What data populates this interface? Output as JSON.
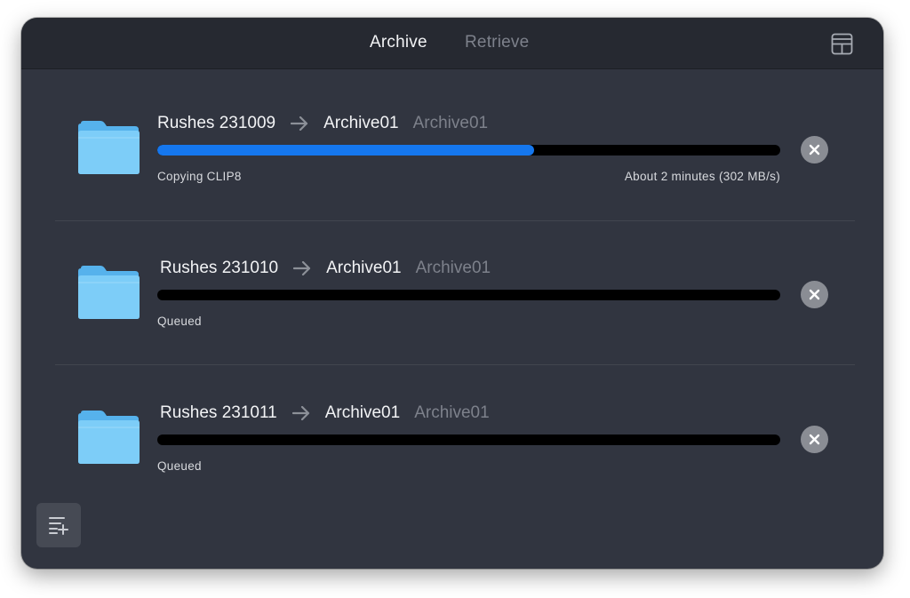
{
  "tabs": {
    "archive": "Archive",
    "retrieve": "Retrieve"
  },
  "jobs": [
    {
      "source": "Rushes 231009",
      "destination": "Archive01",
      "destination_secondary": "Archive01",
      "progress_percent": 60.5,
      "status": "Copying CLIP8",
      "eta": "About 2 minutes (302 MB/s)"
    },
    {
      "source": "Rushes 231010",
      "destination": "Archive01",
      "destination_secondary": "Archive01",
      "progress_percent": 0,
      "status": "Queued",
      "eta": ""
    },
    {
      "source": "Rushes 231011",
      "destination": "Archive01",
      "destination_secondary": "Archive01",
      "progress_percent": 0,
      "status": "Queued",
      "eta": ""
    }
  ],
  "icons": {
    "layout": "layout-toggle-icon",
    "folder": "folder-icon",
    "arrow": "arrow-right-icon",
    "cancel": "close-icon",
    "add_queue": "add-to-queue-icon"
  },
  "colors": {
    "window_bg": "#313540",
    "titlebar_bg": "#262931",
    "progress_fill": "#1577ee",
    "progress_track": "#000000",
    "folder_blue": "#6fc4f5",
    "cancel_bg": "#8a8d94"
  }
}
